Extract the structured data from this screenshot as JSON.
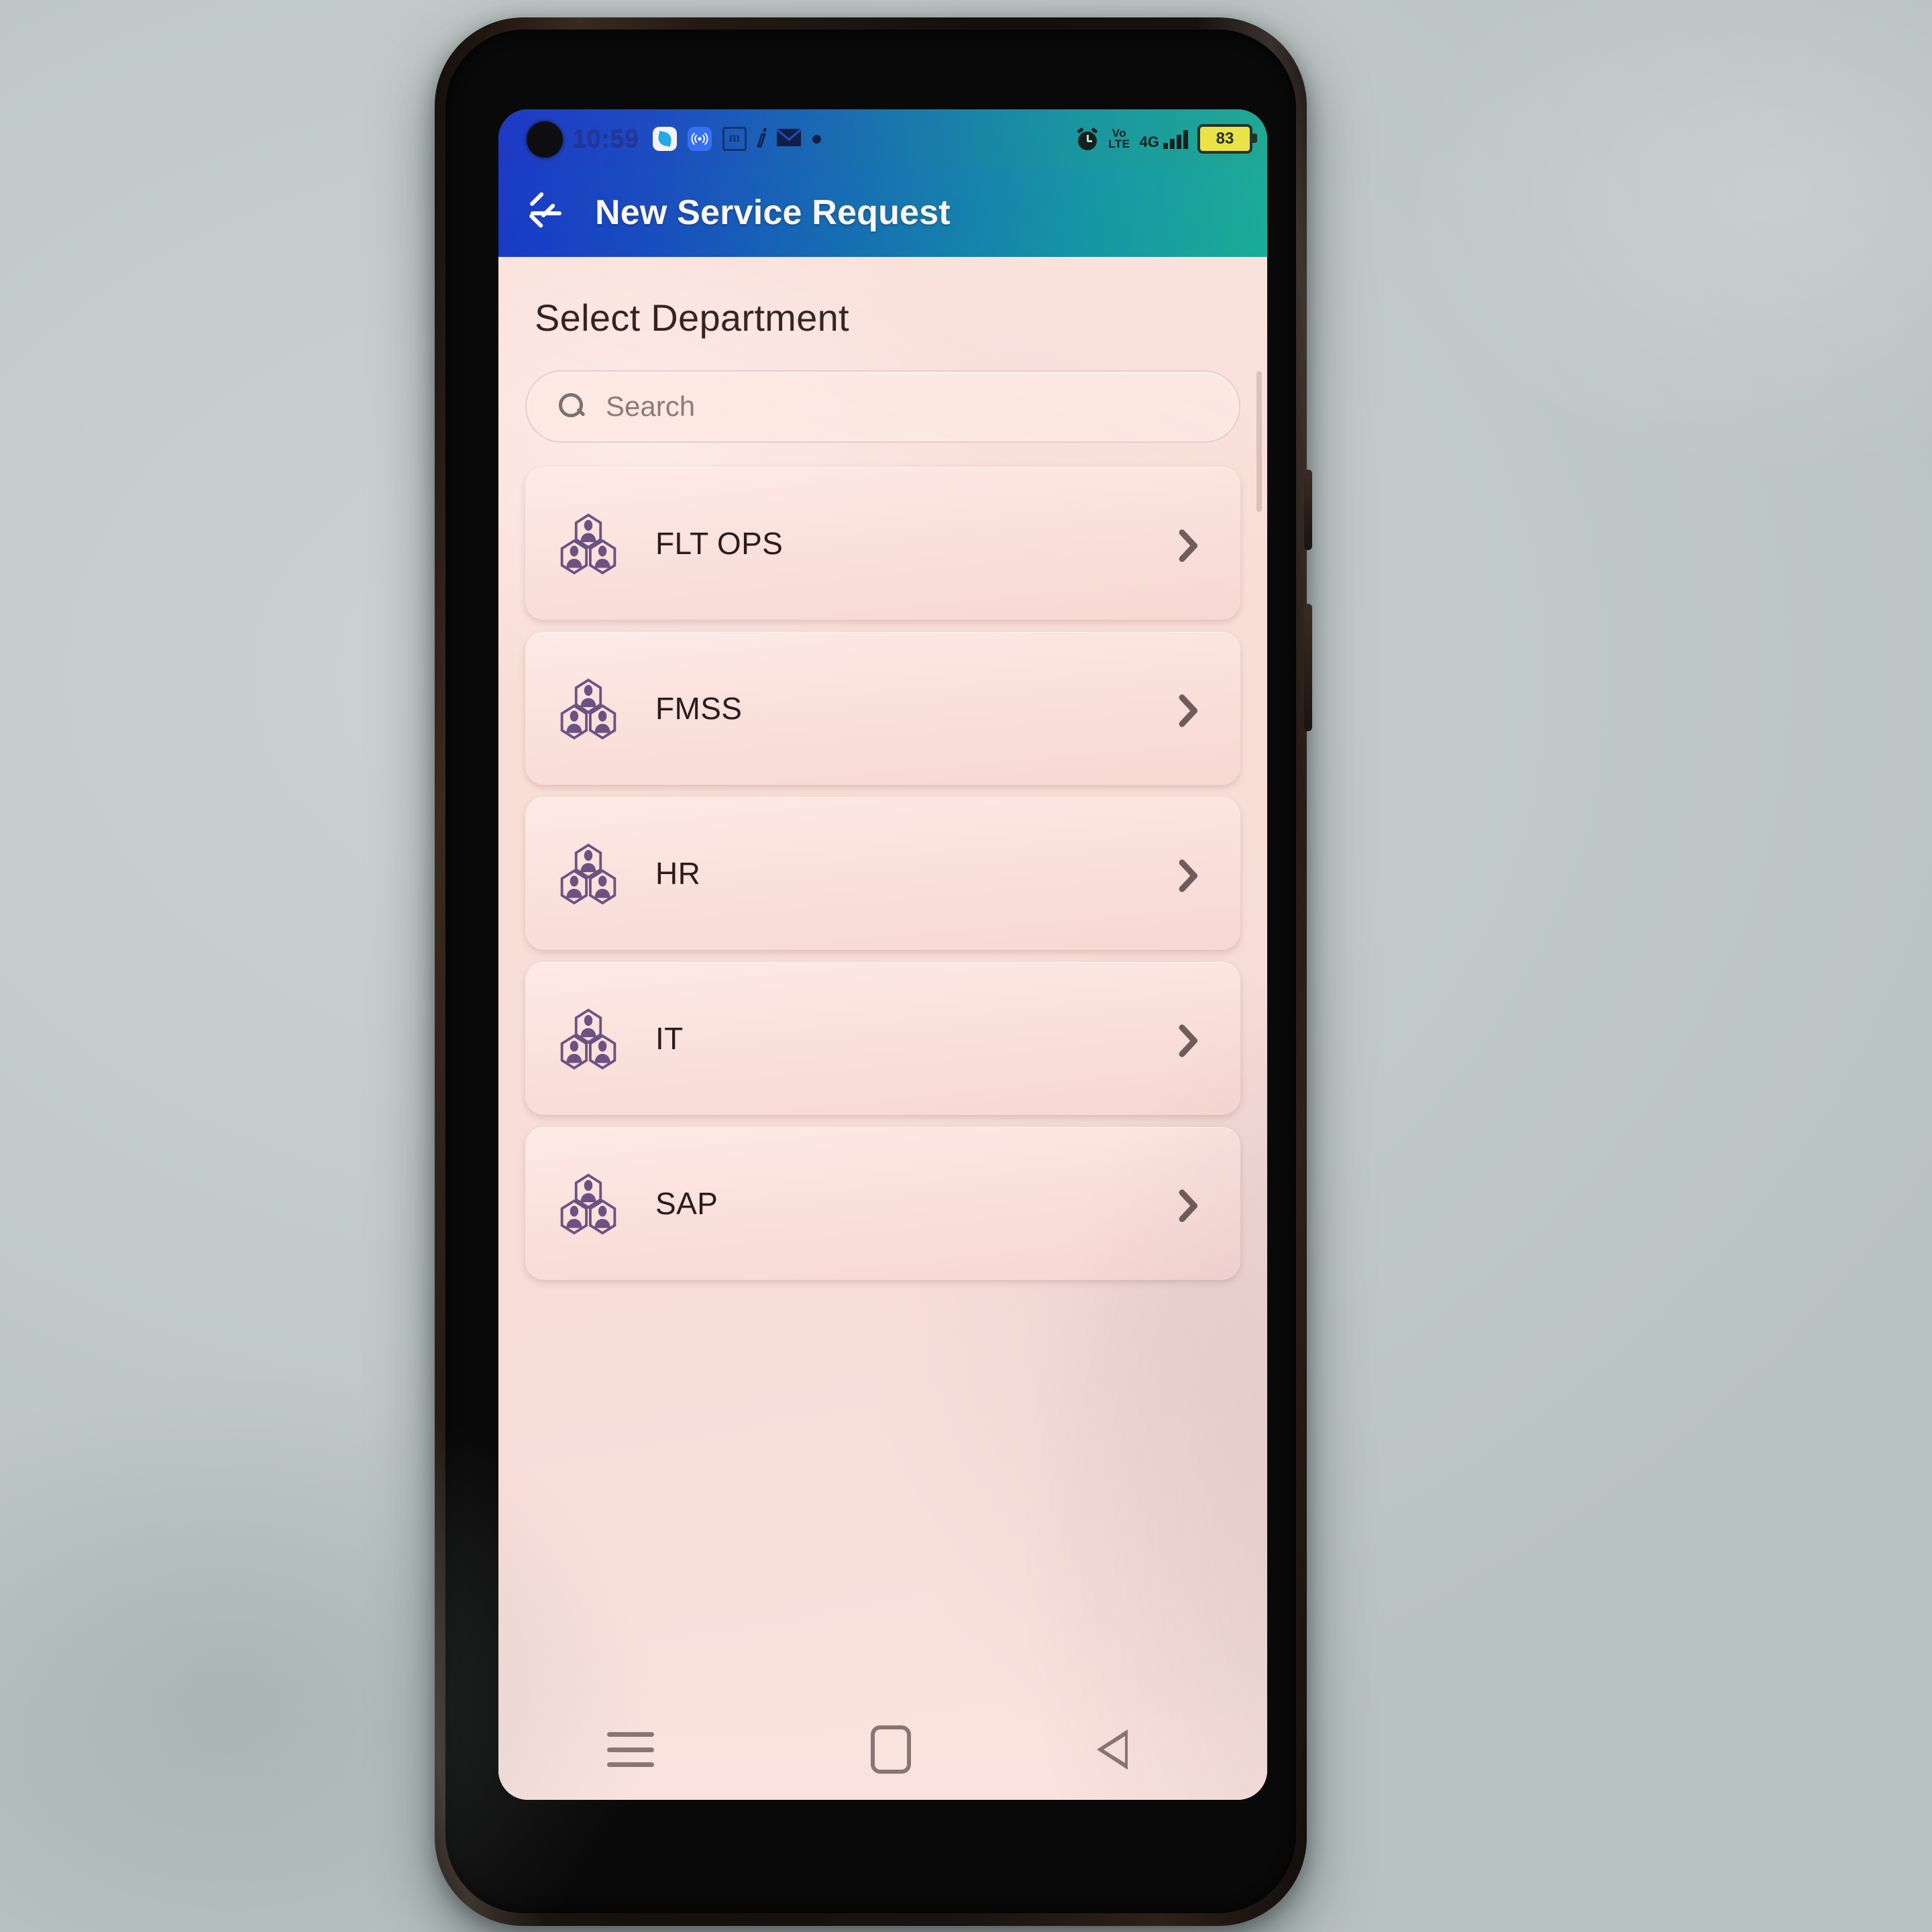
{
  "status_bar": {
    "time": "10:59",
    "battery_level": "83",
    "network_type": "4G",
    "volte_line1": "Vo",
    "volte_line2": "LTE",
    "notification_icons": [
      "leaf-app-icon",
      "cast-icon",
      "m-app-icon",
      "swirl-app-icon",
      "mail-icon",
      "dot-icon"
    ],
    "system_icons": [
      "alarm-icon",
      "volte-icon",
      "signal-bars-icon",
      "battery-icon"
    ],
    "colors": {
      "gradient_start": "#1733c4",
      "gradient_end": "#0fa38e",
      "battery_fill": "#e9e03a"
    }
  },
  "app_bar": {
    "back_label": "Back",
    "title": "New Service Request",
    "colors": {
      "gradient_start": "#1536c7",
      "gradient_end": "#0ea891",
      "title_color": "#fdf6f2"
    }
  },
  "page": {
    "title": "Select Department",
    "background_color": "#f9ded8",
    "text_color": "#33211f"
  },
  "search": {
    "value": "",
    "placeholder": "Search",
    "icon": "search-icon"
  },
  "departments": [
    {
      "label": "FLT OPS",
      "icon": "org-group-icon",
      "chevron": "chevron-right-icon"
    },
    {
      "label": "FMSS",
      "icon": "org-group-icon",
      "chevron": "chevron-right-icon"
    },
    {
      "label": "HR",
      "icon": "org-group-icon",
      "chevron": "chevron-right-icon"
    },
    {
      "label": "IT",
      "icon": "org-group-icon",
      "chevron": "chevron-right-icon"
    },
    {
      "label": "SAP",
      "icon": "org-group-icon",
      "chevron": "chevron-right-icon"
    }
  ],
  "department_icon_color": "#6e5183",
  "nav_bar": {
    "recents_label": "Recents",
    "home_label": "Home",
    "back_label": "Back",
    "icons": [
      "recents-icon",
      "home-icon",
      "back-triangle-icon"
    ]
  }
}
